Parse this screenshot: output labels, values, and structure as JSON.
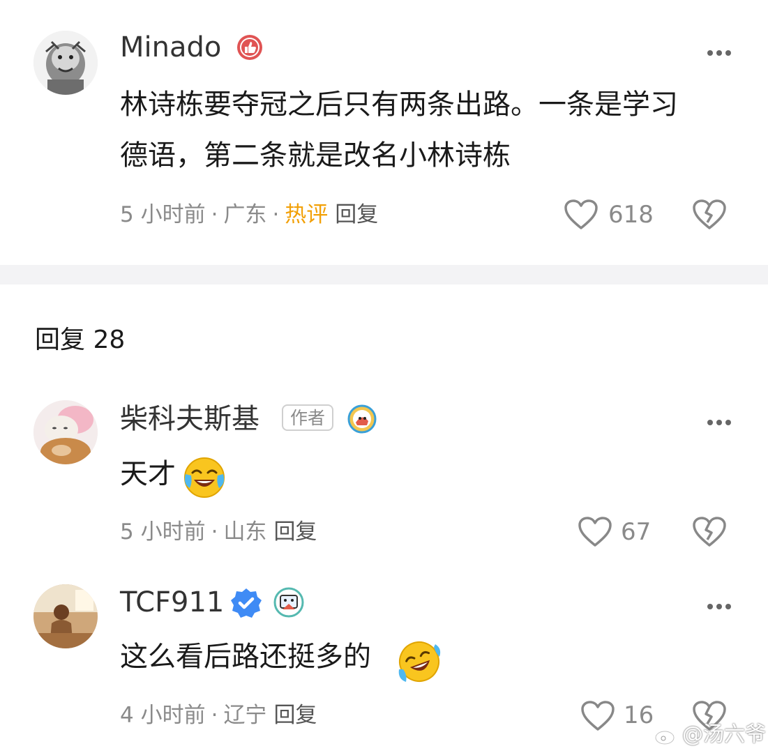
{
  "main_comment": {
    "username": "Minado",
    "badge_icon": "thumbs-up-badge-icon",
    "text_line1": "林诗栋要夺冠之后只有两条出路。一条是学习",
    "text_line2": "德语，第二条就是改名小林诗栋",
    "time": "5 小时前",
    "location": "广东",
    "hot_label": "热评",
    "reply_label": "回复",
    "like_count": "618"
  },
  "replies_section": {
    "title": "回复 28"
  },
  "replies": [
    {
      "username": "柴科夫斯基",
      "author_badge": "作者",
      "text": "天才",
      "emoji": "laughing-crying-emoji",
      "time": "5 小时前",
      "location": "山东",
      "reply_label": "回复",
      "like_count": "67"
    },
    {
      "username": "TCF911",
      "verified_icon": "verified-badge-icon",
      "text": "这么看后路还挺多的",
      "emoji": "rofl-emoji",
      "time": "4 小时前",
      "location": "辽宁",
      "reply_label": "回复",
      "like_count": "16"
    }
  ],
  "watermark": {
    "text": "@汤六爷"
  },
  "colors": {
    "hot": "#f2a007",
    "meta": "#8a8a8a",
    "verified": "#3f8bf5",
    "badge_red": "#e05454"
  }
}
